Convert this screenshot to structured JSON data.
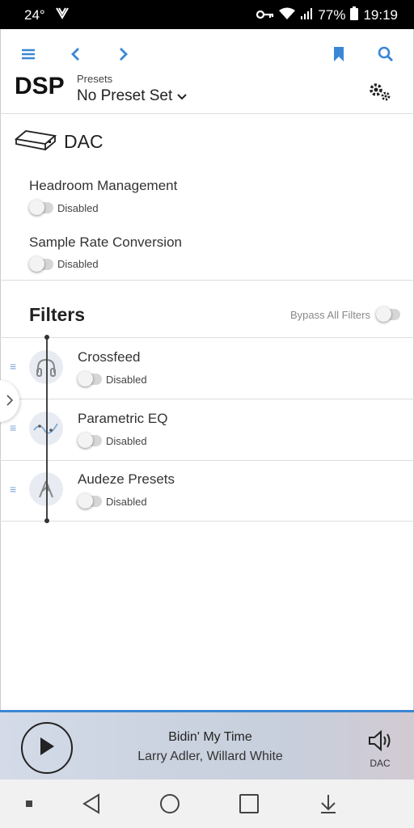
{
  "status": {
    "temperature": "24°",
    "battery": "77%",
    "time": "19:19"
  },
  "header": {
    "title": "DSP",
    "presets_label": "Presets",
    "preset_value": "No Preset Set"
  },
  "dac": {
    "title": "DAC",
    "settings": [
      {
        "name": "Headroom Management",
        "state": "Disabled"
      },
      {
        "name": "Sample Rate Conversion",
        "state": "Disabled"
      }
    ]
  },
  "filters": {
    "title": "Filters",
    "bypass_label": "Bypass All Filters",
    "items": [
      {
        "name": "Crossfeed",
        "state": "Disabled",
        "icon": "headphones-icon"
      },
      {
        "name": "Parametric EQ",
        "state": "Disabled",
        "icon": "eq-curve-icon"
      },
      {
        "name": "Audeze Presets",
        "state": "Disabled",
        "icon": "audeze-logo-icon"
      }
    ]
  },
  "player": {
    "track": "Bidin' My Time",
    "artist": "Larry Adler, Willard White",
    "output": "DAC"
  },
  "colors": {
    "accent": "#3a87d6"
  }
}
